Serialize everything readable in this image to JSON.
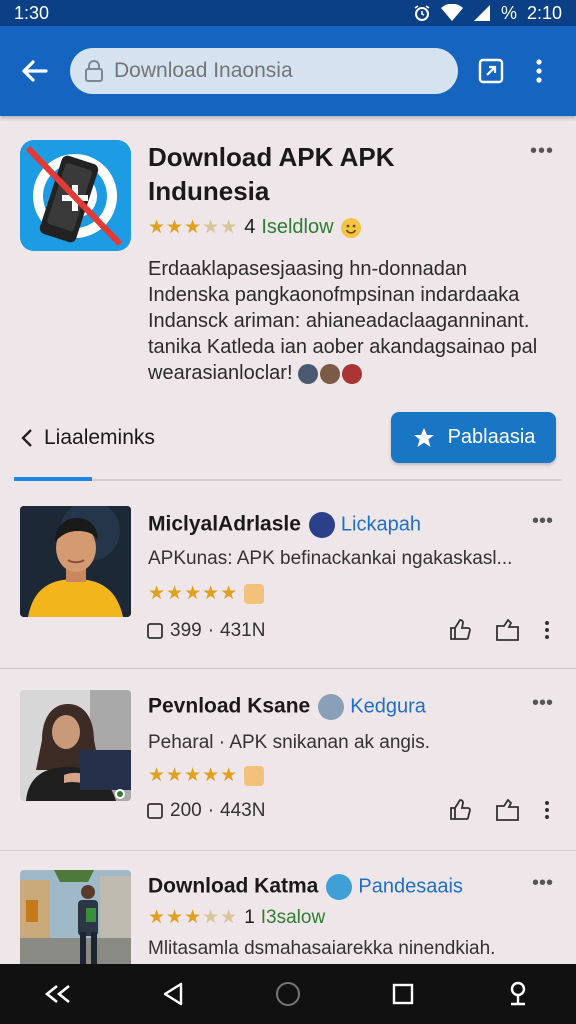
{
  "status": {
    "time_left": "1:30",
    "battery": "%",
    "clock": "2:10"
  },
  "search": {
    "placeholder": "Download Inaonsia"
  },
  "hero": {
    "title": "Download APK APK Indunesia",
    "rating_number": "4",
    "rating_label": "Iseldlow",
    "description": [
      "Erdaaklapasesjaasing hn-donnadan",
      "Indenska pangkaonofmpsinan indardaaka",
      "Indansck ariman: ahianeadaclaaganninant.",
      "tanika Katleda ian aober akandagsainao pal",
      "wearasianloclar!"
    ],
    "links_label": "Liaaleminks",
    "publish_label": "Pablaasia"
  },
  "cards": [
    {
      "title": "MiclyalAdrlasle",
      "tag": "Lickapah",
      "subtitle": "APKunas: APK befinackankai ngakaskasl...",
      "comments": "399",
      "views": "431N"
    },
    {
      "title": "Pevnload Ksane",
      "tag": "Kedgura",
      "subtitle": "Peharal · APK snikanan ak angis.",
      "comments": "200",
      "views": "443N"
    },
    {
      "title": "Download Katma",
      "tag": "Pandesaais",
      "rating_number": "1",
      "rating_label": "I3salow",
      "subtitle": "Mlitasamla dsmahasaiarekka ninendkiah."
    }
  ],
  "colors": {
    "appbar": "#1565c0",
    "statusbar": "#0b3f86",
    "accent": "#1976c4",
    "star": "#e0a21c",
    "background": "#efe6ea"
  }
}
